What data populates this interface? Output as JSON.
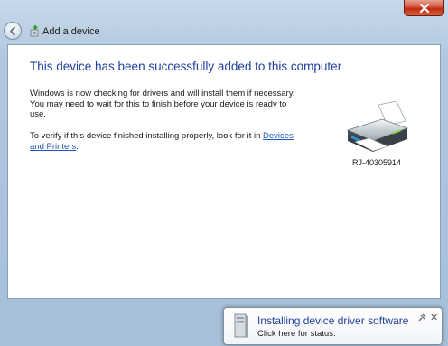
{
  "window": {
    "title": "Add a device",
    "icons": {
      "back": "back-arrow-icon",
      "close": "close-icon",
      "wizard": "add-device-icon"
    }
  },
  "content": {
    "heading": "This device has been successfully added to this computer",
    "para1": "Windows is now checking for drivers and will install them if necessary. You may need to wait for this to finish before your device is ready to use.",
    "para2_text": "To verify if this device finished installing properly, look for it in",
    "para2_link": "Devices and Printers",
    "para2_end": ".",
    "device_name": "RJ-40305914",
    "device_icon": "printer-icon"
  },
  "notification": {
    "title": "Installing device driver software",
    "subtitle": "Click here for status.",
    "icon": "driver-install-icon",
    "pin_icon": "pin-icon",
    "close_icon": "close-icon"
  },
  "colors": {
    "heading": "#1f3e9e",
    "link": "#1f56b8",
    "close_button": "#c8381c"
  }
}
